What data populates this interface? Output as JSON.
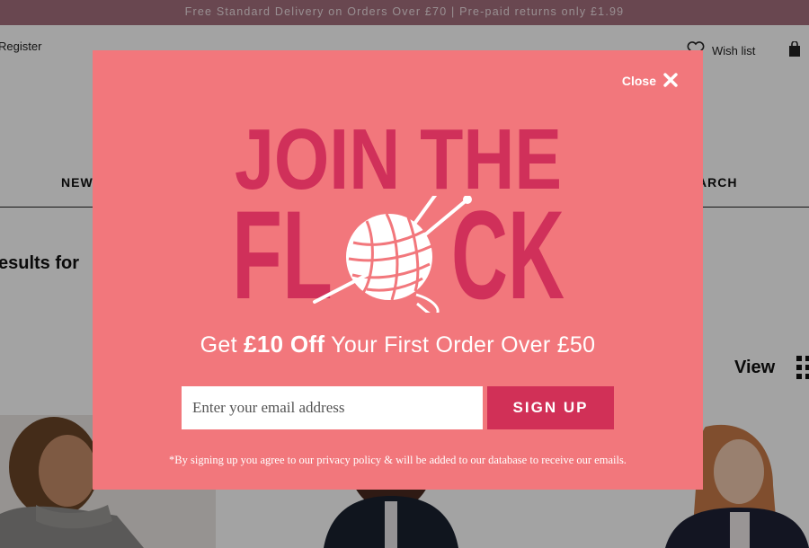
{
  "promo_bar": {
    "text": "Free Standard Delivery on Orders Over £70 | Pre-paid returns only £1.99"
  },
  "header": {
    "register_label": "Register",
    "wishlist_label": "Wish list"
  },
  "nav": {
    "items": [
      {
        "label": "NEW"
      },
      {
        "label": "ARCH"
      }
    ]
  },
  "results": {
    "heading": "esults for"
  },
  "toolbar": {
    "view_label": "View"
  },
  "modal": {
    "close_label": "Close",
    "headline_line1": "JOIN THE",
    "headline_line2_left": "FL",
    "headline_line2_right": "CK",
    "offer_prefix": "Get ",
    "offer_bold": "£10 Off",
    "offer_suffix": " Your First Order Over £50",
    "email_placeholder": "Enter your email address",
    "signup_label": "SIGN UP",
    "disclaimer": "*By signing up you agree to our privacy policy & will be added to our database to receive our emails."
  },
  "colors": {
    "modal_background": "#f2777c",
    "headline": "#d0305a",
    "button": "#d13057",
    "promo_bar": "#a5707e"
  }
}
